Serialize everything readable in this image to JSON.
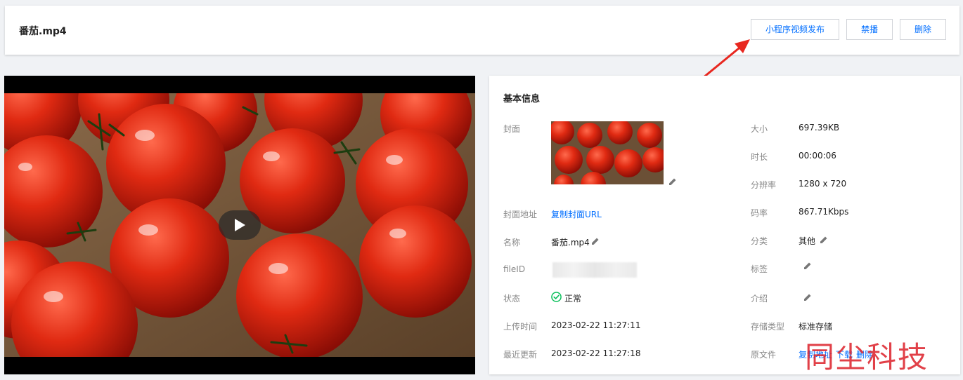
{
  "header": {
    "title": "番茄.mp4",
    "buttons": {
      "publish": "小程序视频发布",
      "ban": "禁播",
      "delete": "删除"
    }
  },
  "video": {
    "play_icon": "play-icon"
  },
  "info": {
    "title": "基本信息",
    "left": {
      "cover_label": "封面",
      "cover_url_label": "封面地址",
      "cover_url_value": "复制封面URL",
      "name_label": "名称",
      "name_value": "番茄.mp4",
      "fileid_label": "fileID",
      "status_label": "状态",
      "status_value": "正常",
      "upload_time_label": "上传时间",
      "upload_time_value": "2023-02-22 11:27:11",
      "updated_label": "最近更新",
      "updated_value": "2023-02-22 11:27:18"
    },
    "right": {
      "size_label": "大小",
      "size_value": "697.39KB",
      "duration_label": "时长",
      "duration_value": "00:00:06",
      "resolution_label": "分辨率",
      "resolution_value": "1280 x 720",
      "bitrate_label": "码率",
      "bitrate_value": "867.71Kbps",
      "category_label": "分类",
      "category_value": "其他",
      "tags_label": "标签",
      "intro_label": "介绍",
      "storage_label": "存储类型",
      "storage_value": "标准存储",
      "source_label": "原文件",
      "source_copy": "复制地址",
      "source_download": "下载",
      "source_delete": "删除"
    }
  },
  "watermark": "同尘科技",
  "colors": {
    "link": "#006eff",
    "success": "#0abf5b",
    "arrow": "#e8271f"
  }
}
